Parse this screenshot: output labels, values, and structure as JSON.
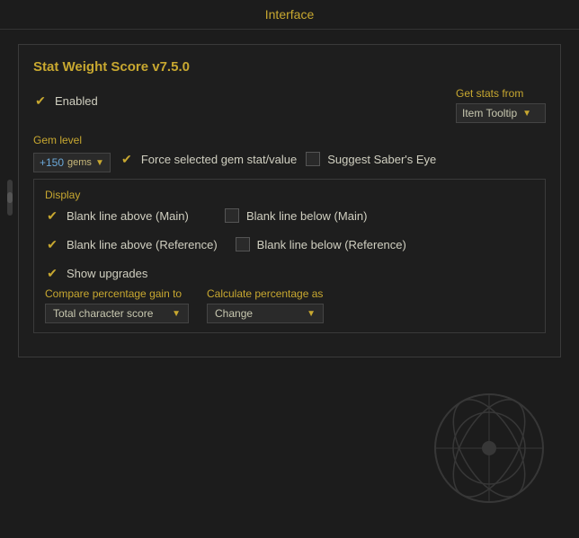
{
  "topbar": {
    "title": "Interface"
  },
  "panel": {
    "title": "Stat Weight Score v7.5.0",
    "get_stats_from_label": "Get stats from",
    "get_stats_dropdown": "Item Tooltip",
    "enabled_label": "Enabled",
    "enabled_checked": true,
    "gem_level_label": "Gem level",
    "gem_value": "+150",
    "gems_label": "gems",
    "force_gem_checkbox": true,
    "force_gem_label": "Force selected gem stat/value",
    "sabers_eye_checkbox": false,
    "sabers_eye_label": "Suggest Saber's Eye",
    "display": {
      "title": "Display",
      "blank_above_main_checked": true,
      "blank_above_main_label": "Blank line above (Main)",
      "blank_below_main_checked": false,
      "blank_below_main_label": "Blank line below (Main)",
      "blank_above_ref_checked": true,
      "blank_above_ref_label": "Blank line above (Reference)",
      "blank_below_ref_checked": false,
      "blank_below_ref_label": "Blank line below (Reference)",
      "show_upgrades_checked": true,
      "show_upgrades_label": "Show upgrades"
    },
    "compare_label": "Compare percentage gain to",
    "compare_dropdown": "Total character score",
    "calculate_label": "Calculate percentage as",
    "calculate_dropdown": "Change"
  }
}
